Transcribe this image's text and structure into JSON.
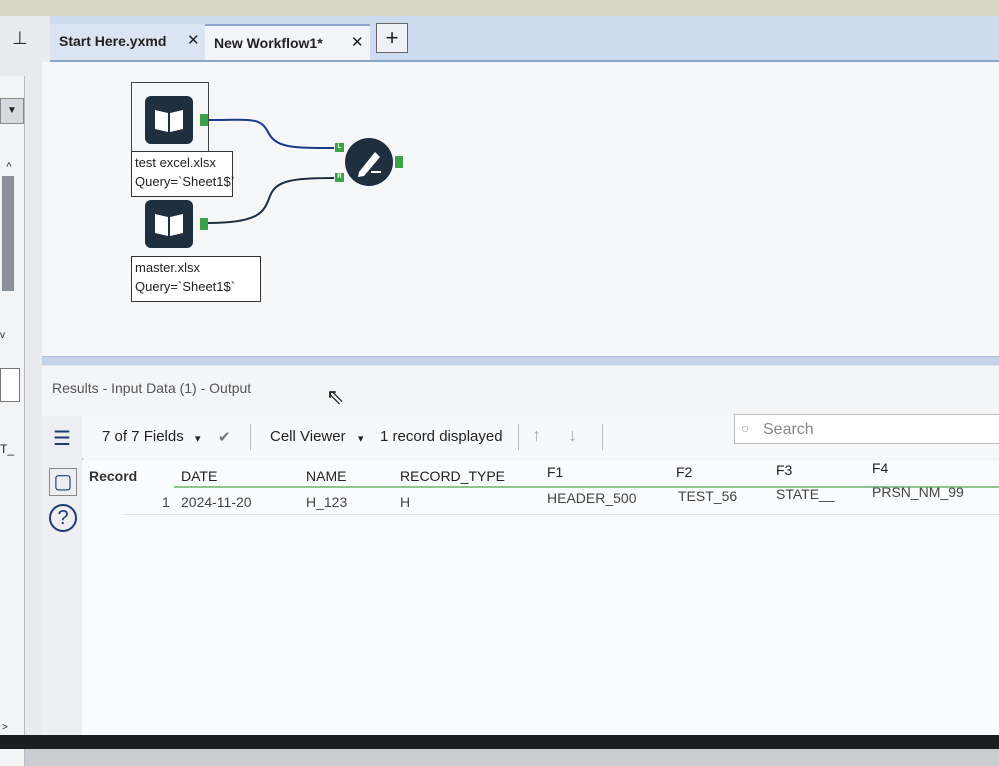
{
  "tabs": [
    {
      "label": "Start Here.yxmd"
    },
    {
      "label": "New Workflow1*"
    }
  ],
  "tab_close_glyph": "✕",
  "tab_add_glyph": "+",
  "canvas": {
    "tools": [
      {
        "label_line1": "test excel.xlsx",
        "label_line2": "Query=`Sheet1$`"
      },
      {
        "label_line1": "master.xlsx",
        "label_line2": "Query=`Sheet1$`"
      }
    ],
    "join_anchors": {
      "left": "L",
      "right": "R"
    }
  },
  "left_dock": {
    "partial_text": "T_"
  },
  "results": {
    "title": "Results - Input Data (1) - Output",
    "fields_selector": "7 of 7 Fields",
    "cell_viewer": "Cell Viewer",
    "record_count": "1 record displayed",
    "search_placeholder": "Search",
    "columns": [
      "Record",
      "DATE",
      "NAME",
      "RECORD_TYPE",
      "F1",
      "F2",
      "F3",
      "F4"
    ],
    "rows": [
      [
        "1",
        "2024-11-20",
        "H_123",
        "H",
        "HEADER_500",
        "TEST_56",
        "STATE__",
        "PRSN_NM_99"
      ]
    ]
  }
}
